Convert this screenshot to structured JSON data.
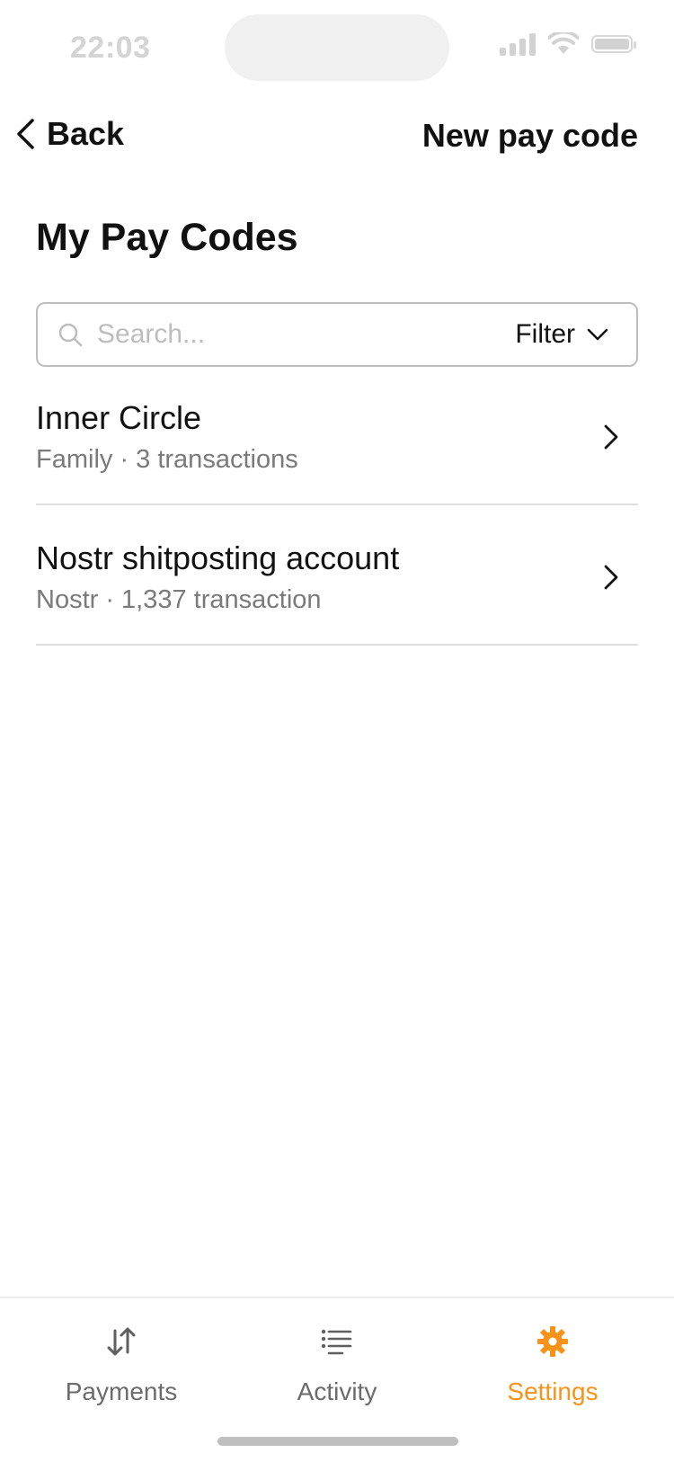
{
  "status_bar": {
    "time": "22:03"
  },
  "nav": {
    "back_label": "Back",
    "action_label": "New pay code"
  },
  "page": {
    "title": "My Pay Codes"
  },
  "search": {
    "placeholder": "Search...",
    "value": "",
    "filter_label": "Filter"
  },
  "pay_codes": [
    {
      "title": "Inner Circle",
      "subtitle": "Family · 3 transactions"
    },
    {
      "title": "Nostr shitposting account",
      "subtitle": "Nostr · 1,337 transaction"
    }
  ],
  "tabs": [
    {
      "label": "Payments",
      "icon": "payments-arrows-icon",
      "active": false
    },
    {
      "label": "Activity",
      "icon": "activity-list-icon",
      "active": false
    },
    {
      "label": "Settings",
      "icon": "gear-icon",
      "active": true
    }
  ],
  "colors": {
    "accent": "#f7931a",
    "muted_text": "#7a7a7a",
    "divider": "#dedede"
  }
}
